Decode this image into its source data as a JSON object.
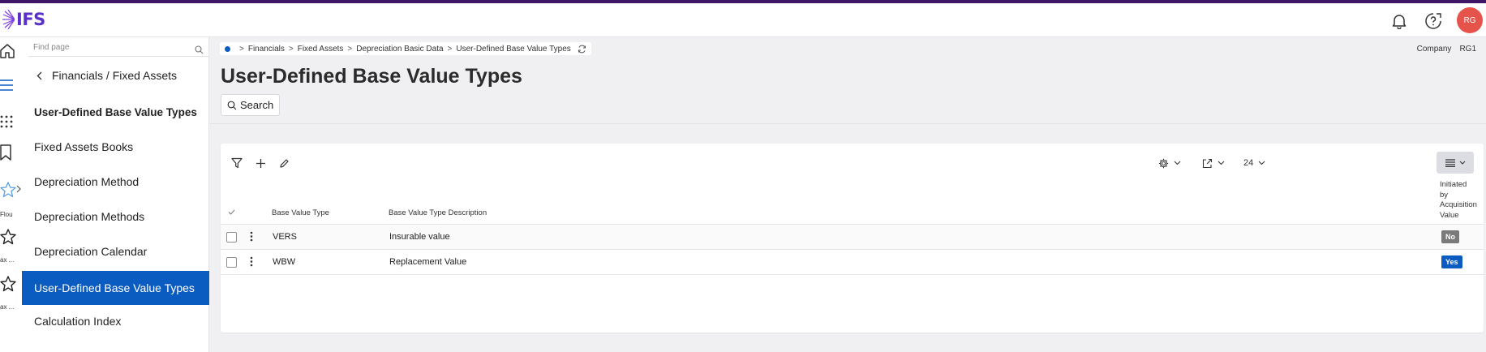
{
  "app": {
    "logo_text": "IFS",
    "avatar_initials": "RG",
    "brand_color": "#5b2fc9",
    "accent_color": "#0b5cc1"
  },
  "rail": {
    "items": [
      {
        "icon": "home-icon"
      },
      {
        "icon": "menu-icon"
      },
      {
        "icon": "apps-grid-icon"
      },
      {
        "icon": "bookmark-icon"
      },
      {
        "icon": "star-icon",
        "label": "Flou"
      },
      {
        "icon": "star-icon",
        "label": "ax ..."
      },
      {
        "icon": "star-icon",
        "label": "ax ..."
      }
    ]
  },
  "nav": {
    "search_placeholder": "Find page",
    "back_label": "Financials / Fixed Assets",
    "current_title": "User-Defined Base Value Types",
    "items": [
      {
        "label": "Fixed Assets Books"
      },
      {
        "label": "Depreciation Method"
      },
      {
        "label": "Depreciation Methods"
      },
      {
        "label": "Depreciation Calendar"
      },
      {
        "label": "User-Defined Base Value Types",
        "active": true
      },
      {
        "label": "Calculation Index"
      }
    ]
  },
  "breadcrumb": [
    "Financials",
    "Fixed Assets",
    "Depreciation Basic Data",
    "User-Defined Base Value Types"
  ],
  "company": {
    "label": "Company",
    "value": "RG1"
  },
  "page": {
    "title": "User-Defined Base Value Types",
    "search_label": "Search"
  },
  "toolbar": {
    "page_size": "24"
  },
  "table": {
    "columns": [
      "Base Value Type",
      "Base Value Type Description"
    ],
    "bool_column": [
      "Initiated",
      "by",
      "Acquisition",
      "Value"
    ],
    "rows": [
      {
        "type": "VERS",
        "description": "Insurable value",
        "initiated": "No",
        "initiated_color": "#7a7a7a"
      },
      {
        "type": "WBW",
        "description": "Replacement Value",
        "initiated": "Yes",
        "initiated_color": "#0b5cc1"
      }
    ]
  }
}
